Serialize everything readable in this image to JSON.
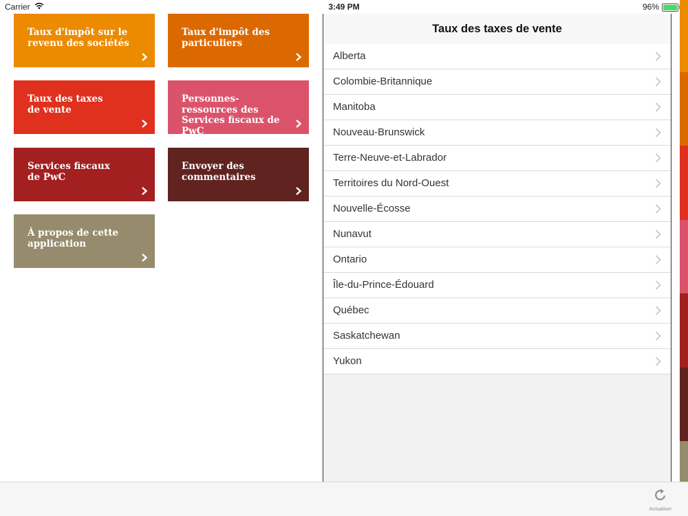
{
  "status_bar": {
    "carrier": "Carrier",
    "time": "3:49 PM",
    "battery": "96%"
  },
  "tiles": [
    {
      "label": "Taux d'impôt sur le\nrevenu des sociétés",
      "color": "#ec8a00"
    },
    {
      "label": "Taux d'impôt des\nparticuliers",
      "color": "#dc6900"
    },
    {
      "label": "Taux des taxes\nde vente",
      "color": "#e0301e"
    },
    {
      "label": "Personnes-\nressources des\nServices fiscaux de\nPwC",
      "color": "#db536a"
    },
    {
      "label": "Services fiscaux\nde PwC",
      "color": "#a32020"
    },
    {
      "label": "Envoyer des\ncommentaires",
      "color": "#602320"
    },
    {
      "label": "À propos de cette\napplication",
      "color": "#968c6d"
    }
  ],
  "panel": {
    "title": "Taux des taxes de vente",
    "items": [
      "Alberta",
      "Colombie-Britannique",
      "Manitoba",
      "Nouveau-Brunswick",
      "Terre-Neuve-et-Labrador",
      "Territoires du Nord-Ouest",
      "Nouvelle-Écosse",
      "Nunavut",
      "Ontario",
      "Île-du-Prince-Édouard",
      "Québec",
      "Saskatchewan",
      "Yukon"
    ]
  },
  "toolbar": {
    "refresh_label": "Actualiser"
  },
  "colors": {
    "strip": [
      "#ec8a00",
      "#dc6900",
      "#e0301e",
      "#db536a",
      "#a32020",
      "#602320",
      "#968c6d"
    ]
  }
}
